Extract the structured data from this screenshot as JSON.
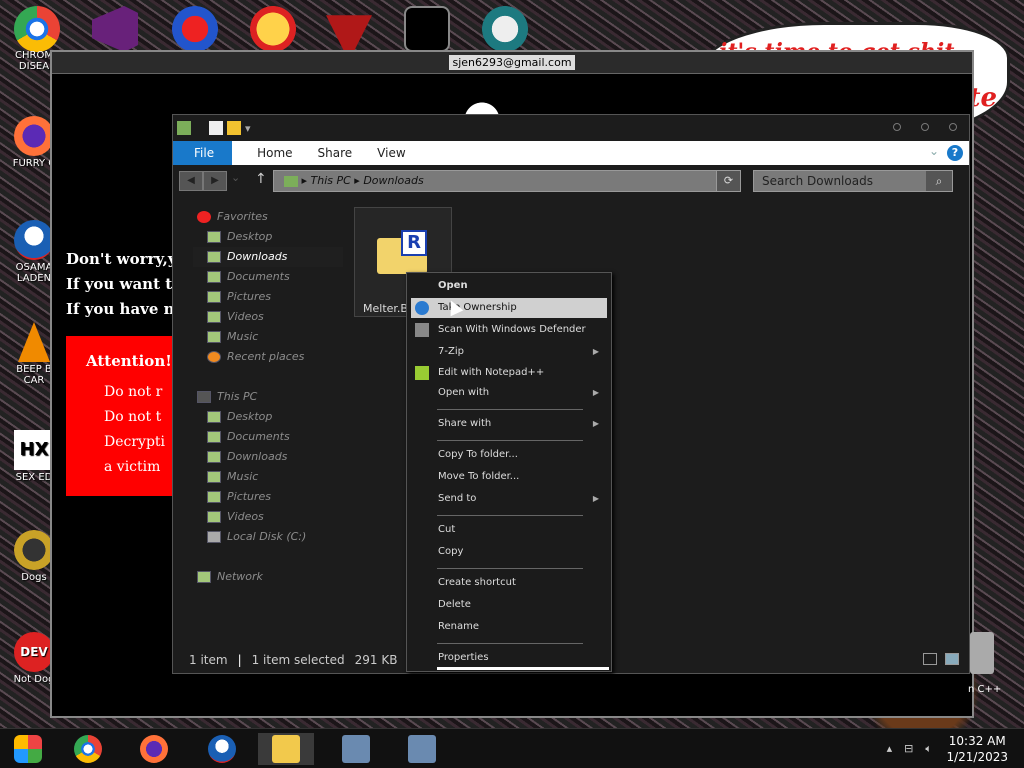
{
  "desktop": {
    "icons": [
      {
        "label": "CHROM\nDISEA"
      },
      {
        "label": "FURRY C"
      },
      {
        "label": "OSAMA\nLADEN"
      },
      {
        "label": "BEEP B\nCAR"
      },
      {
        "label": "SEX ED"
      },
      {
        "label": "Dogs"
      },
      {
        "label": "Not Dog"
      }
    ],
    "right_bottom_label": "n C++"
  },
  "ransom": {
    "email": "sjen6293@gmail.com",
    "lines": [
      "Don't worry,yo",
      "If you want to",
      "If you have no"
    ],
    "attention_title": "Attention!",
    "bullets": [
      "Do not r",
      "Do not t",
      "Decrypti",
      "a victim"
    ],
    "meme_text": "it's time to get shit",
    "meme_side": "te"
  },
  "explorer": {
    "ribbon": {
      "file": "File",
      "tabs": [
        "Home",
        "Share",
        "View"
      ],
      "help": "?"
    },
    "address": {
      "parts": [
        "This PC",
        "Downloads"
      ]
    },
    "search_placeholder": "Search Downloads",
    "nav": {
      "favorites": "Favorites",
      "fav_items": [
        "Desktop",
        "Downloads",
        "Documents",
        "Pictures",
        "Videos",
        "Music",
        "Recent places"
      ],
      "thispc": "This PC",
      "pc_items": [
        "Desktop",
        "Documents",
        "Downloads",
        "Music",
        "Pictures",
        "Videos",
        "Local Disk (C:)"
      ],
      "network": "Network"
    },
    "file": {
      "name": "Melter.B",
      "badge": "R"
    },
    "status": {
      "count": "1 item",
      "selected": "1 item selected",
      "size": "291 KB"
    }
  },
  "context_menu": {
    "items": [
      "Open",
      "Take Ownership",
      "Scan With Windows Defender",
      "7-Zip",
      "Edit with Notepad++",
      "Open with",
      "Share with",
      "Copy To folder...",
      "Move To folder...",
      "Send to",
      "Cut",
      "Copy",
      "Create shortcut",
      "Delete",
      "Rename",
      "Properties"
    ]
  },
  "taskbar": {
    "time": "10:32 AM",
    "date": "1/21/2023"
  },
  "colors": {
    "accent": "#1979ca",
    "attention": "#ff0000"
  }
}
